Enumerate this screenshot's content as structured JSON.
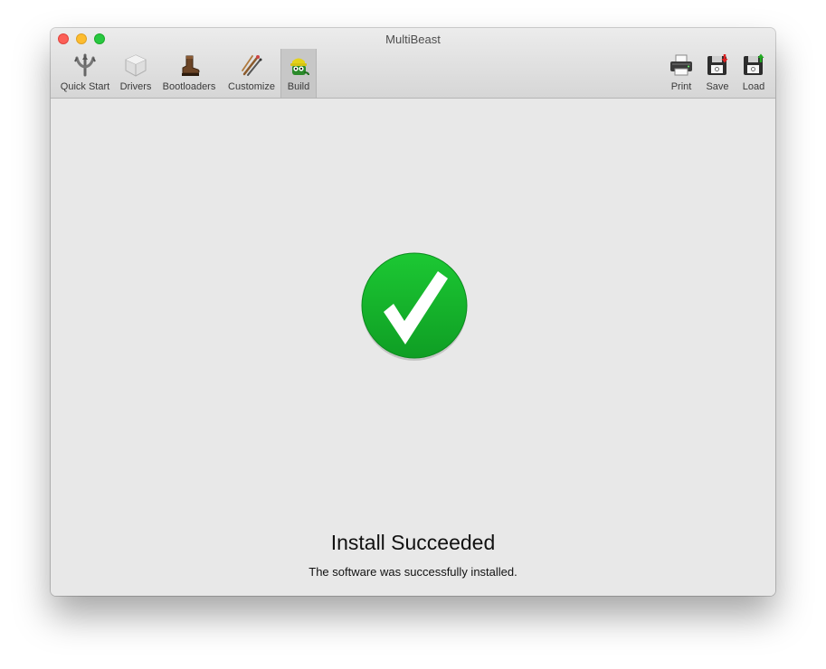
{
  "window": {
    "title": "MultiBeast"
  },
  "toolbar": {
    "left_items": [
      {
        "label": "Quick Start",
        "icon": "trident-icon"
      },
      {
        "label": "Drivers",
        "icon": "cube-icon"
      },
      {
        "label": "Bootloaders",
        "icon": "boot-icon"
      },
      {
        "label": "Customize",
        "icon": "brushes-icon"
      },
      {
        "label": "Build",
        "icon": "build-mascot-icon",
        "selected": true
      }
    ],
    "right_items": [
      {
        "label": "Print",
        "icon": "printer-icon"
      },
      {
        "label": "Save",
        "icon": "save-disk-icon"
      },
      {
        "label": "Load",
        "icon": "load-disk-icon"
      }
    ]
  },
  "status": {
    "icon": "checkmark-success-icon",
    "title": "Install Succeeded",
    "message": "The software was successfully installed."
  },
  "colors": {
    "success_green": "#14b32c",
    "close": "#fc5f57",
    "minimize": "#fdbc2e",
    "maximize": "#28c840"
  }
}
